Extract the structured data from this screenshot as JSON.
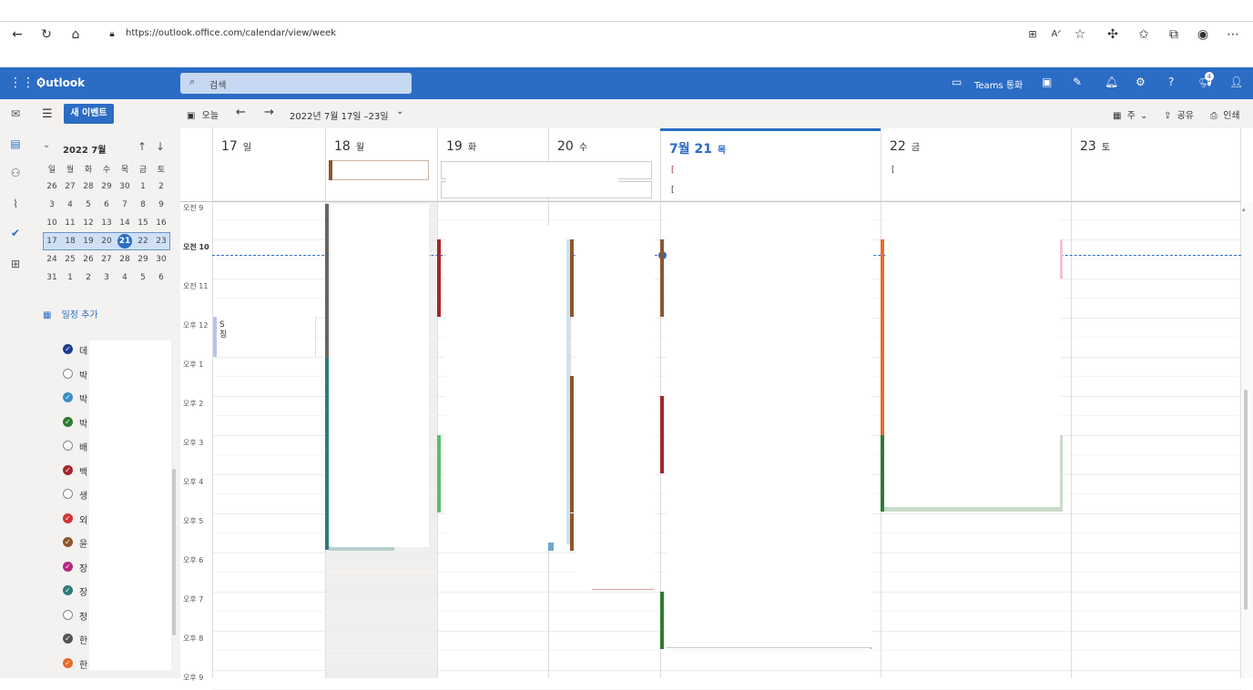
{
  "browser": {
    "url": "https://outlook.office.com/calendar/view/week",
    "icons": [
      "back-arrow-icon",
      "refresh-icon",
      "home-icon",
      "lock-icon"
    ]
  },
  "appbar": {
    "brand": "Outlook",
    "search_placeholder": "검색",
    "teams_label": "Teams 통화",
    "notification_count": "4"
  },
  "toolbar": {
    "new_event": "새 이벤트",
    "today": "오늘",
    "date_range": "2022년 7월 17일 –23일",
    "view": "주",
    "share": "공유",
    "print": "인쇄"
  },
  "mini_calendar": {
    "title": "2022 7월",
    "weekdays": [
      "일",
      "월",
      "화",
      "수",
      "목",
      "금",
      "토"
    ],
    "weeks": [
      [
        "26",
        "27",
        "28",
        "29",
        "30",
        "1",
        "2"
      ],
      [
        "3",
        "4",
        "5",
        "6",
        "7",
        "8",
        "9"
      ],
      [
        "10",
        "11",
        "12",
        "13",
        "14",
        "15",
        "16"
      ],
      [
        "17",
        "18",
        "19",
        "20",
        "21",
        "22",
        "23"
      ],
      [
        "24",
        "25",
        "26",
        "27",
        "28",
        "29",
        "30"
      ],
      [
        "31",
        "1",
        "2",
        "3",
        "4",
        "5",
        "6"
      ]
    ],
    "today": "21"
  },
  "add_calendar": "일정 추가",
  "calendars": [
    {
      "label": "데",
      "checked": true,
      "color": "#1f3b8f"
    },
    {
      "label": "박",
      "checked": false,
      "color": "#888888"
    },
    {
      "label": "박",
      "checked": true,
      "color": "#3b8fc4"
    },
    {
      "label": "박",
      "checked": true,
      "color": "#2e7d32"
    },
    {
      "label": "배",
      "checked": false,
      "color": "#888888"
    },
    {
      "label": "백",
      "checked": true,
      "color": "#a4262c"
    },
    {
      "label": "생",
      "checked": false,
      "color": "#888888"
    },
    {
      "label": "외",
      "checked": true,
      "color": "#d13438"
    },
    {
      "label": "윤",
      "checked": true,
      "color": "#8e562e"
    },
    {
      "label": "장",
      "checked": true,
      "color": "#b4287d"
    },
    {
      "label": "장",
      "checked": true,
      "color": "#2f7a7a"
    },
    {
      "label": "정",
      "checked": false,
      "color": "#888888"
    },
    {
      "label": "한",
      "checked": true,
      "color": "#555555"
    },
    {
      "label": "한",
      "checked": true,
      "color": "#e86b2b"
    }
  ],
  "days": [
    {
      "num": "17",
      "dow": "일"
    },
    {
      "num": "18",
      "dow": "월"
    },
    {
      "num": "19",
      "dow": "화"
    },
    {
      "num": "20",
      "dow": "수"
    },
    {
      "num": "7월 21",
      "dow": "목"
    },
    {
      "num": "22",
      "dow": "금"
    },
    {
      "num": "23",
      "dow": "토"
    }
  ],
  "time_labels": [
    "오전 9",
    "오전 10",
    "오전 11",
    "오후 12",
    "오후 1",
    "오후 2",
    "오후 3",
    "오후 4",
    "오후 5",
    "오후 6",
    "오후 7",
    "오후 8",
    "오후 9"
  ],
  "allday_events": {
    "thu_1": "[",
    "thu_2": "[",
    "fri_1": "["
  },
  "sunday_event_text": "S\n칭",
  "colors": {
    "brand_blue": "#2b6cc5",
    "brown": "#8e562e",
    "dark_red": "#a4262c",
    "teal": "#2f7a7a",
    "green": "#2e7d32",
    "orange": "#e86b2b"
  }
}
